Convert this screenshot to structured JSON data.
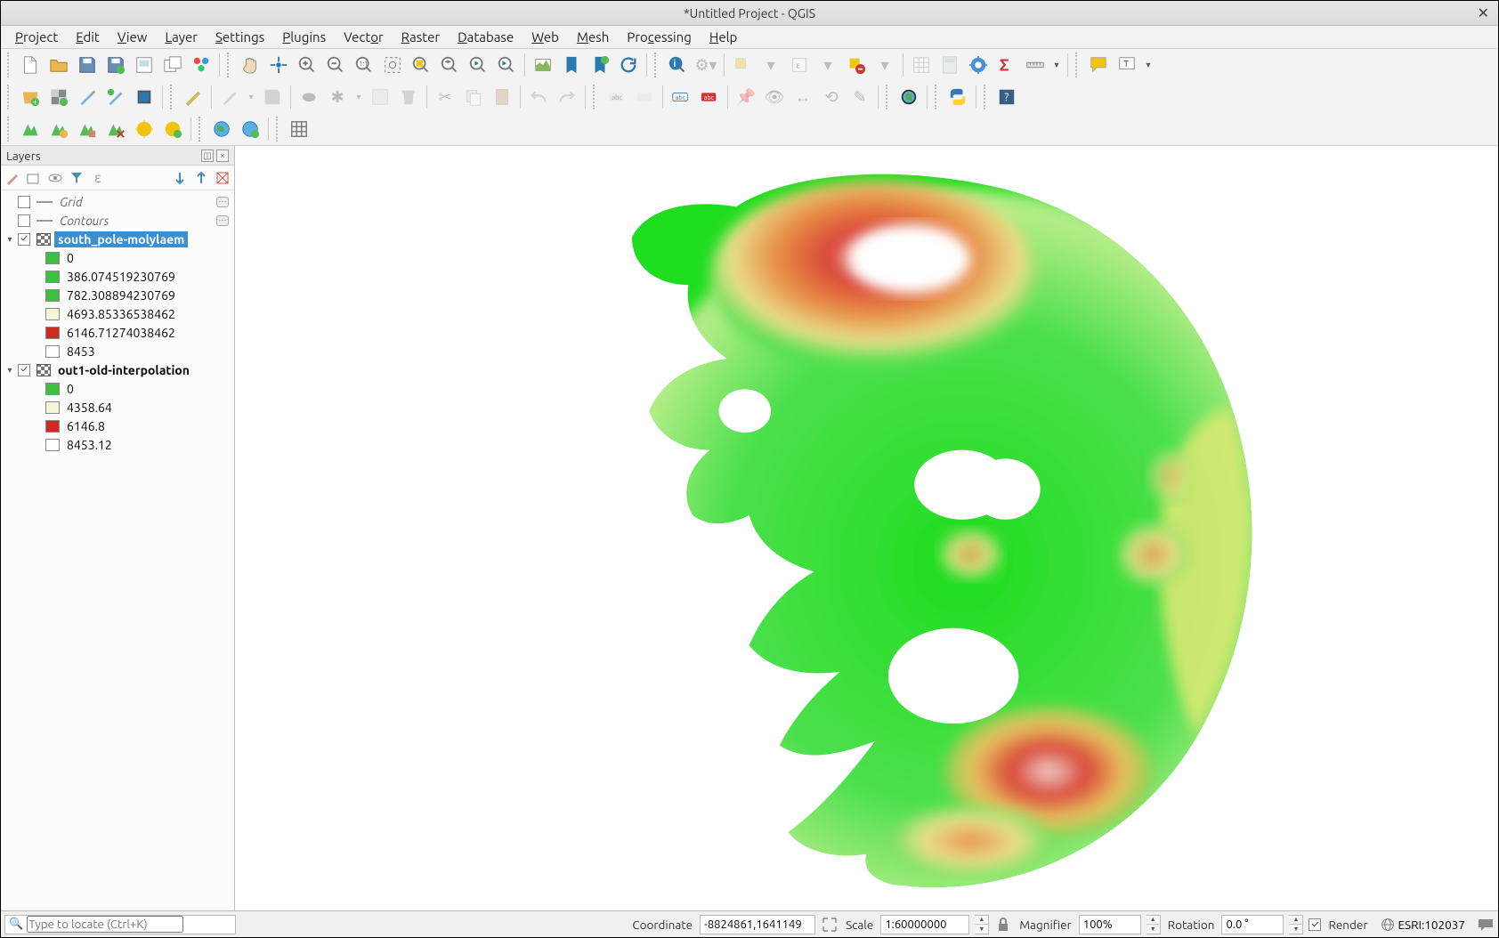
{
  "window": {
    "title": "*Untitled Project - QGIS"
  },
  "menu": [
    "Project",
    "Edit",
    "View",
    "Layer",
    "Settings",
    "Plugins",
    "Vector",
    "Raster",
    "Database",
    "Web",
    "Mesh",
    "Processing",
    "Help"
  ],
  "layers_panel": {
    "title": "Layers",
    "items": [
      {
        "type": "layer",
        "label": "Grid",
        "italic": true,
        "checked": false,
        "expander": "",
        "icon": "line",
        "rbtn": true
      },
      {
        "type": "layer",
        "label": "Contours",
        "italic": true,
        "checked": false,
        "expander": "",
        "icon": "line",
        "rbtn": true
      },
      {
        "type": "layer",
        "label": "south_pole-molylaem",
        "bold": true,
        "checked": true,
        "expander": "▾",
        "icon": "raster",
        "selected": true,
        "legend": [
          {
            "color": "#3fbf3f",
            "label": "0"
          },
          {
            "color": "#3fbf3f",
            "label": "386.074519230769"
          },
          {
            "color": "#3fbf3f",
            "label": "782.308894230769"
          },
          {
            "color": "#f7f5d7",
            "label": "4693.85336538462"
          },
          {
            "color": "#cc2a25",
            "label": "6146.71274038462"
          },
          {
            "color": "#ffffff",
            "label": "8453"
          }
        ]
      },
      {
        "type": "layer",
        "label": "out1-old-interpolation",
        "bold": true,
        "checked": true,
        "expander": "▾",
        "icon": "raster",
        "legend": [
          {
            "color": "#3fbf3f",
            "label": "0"
          },
          {
            "color": "#f7f5d7",
            "label": "4358.64"
          },
          {
            "color": "#cc2a25",
            "label": "6146.8"
          },
          {
            "color": "#ffffff",
            "label": "8453.12"
          }
        ]
      }
    ]
  },
  "statusbar": {
    "locator_placeholder": "Type to locate (Ctrl+K)",
    "coord_label": "Coordinate",
    "coord_value": "-8824861,1641149",
    "scale_label": "Scale",
    "scale_value": "1:60000000",
    "magnifier_label": "Magnifier",
    "magnifier_value": "100%",
    "rotation_label": "Rotation",
    "rotation_value": "0.0 °",
    "render_label": "Render",
    "crs_label": "ESRI:102037"
  }
}
